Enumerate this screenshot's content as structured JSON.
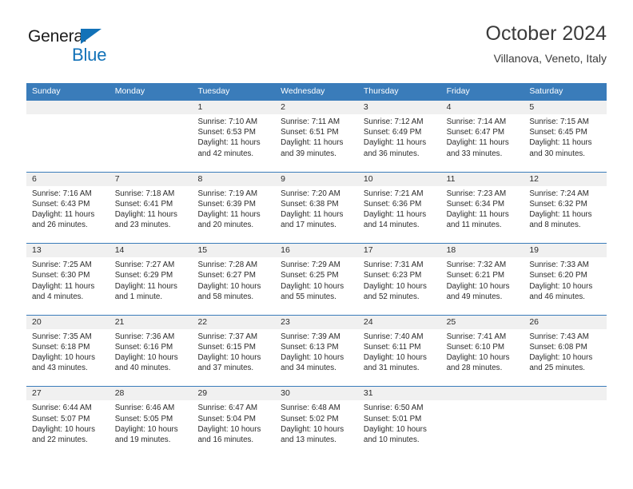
{
  "brand": {
    "name_top": "General",
    "name_bottom": "Blue",
    "triangle_color": "#1272b8",
    "text_color": "#1b1b1b"
  },
  "header": {
    "title": "October 2024",
    "subtitle": "Villanova, Veneto, Italy"
  },
  "colors": {
    "header_blue": "#3a7cba",
    "daynum_strip": "#f0f0f0",
    "text": "#2b2b2b"
  },
  "weekdays": [
    "Sunday",
    "Monday",
    "Tuesday",
    "Wednesday",
    "Thursday",
    "Friday",
    "Saturday"
  ],
  "weeks": [
    [
      {
        "day": "",
        "sunrise": "",
        "sunset": "",
        "daylight_line1": "",
        "daylight_line2": ""
      },
      {
        "day": "",
        "sunrise": "",
        "sunset": "",
        "daylight_line1": "",
        "daylight_line2": ""
      },
      {
        "day": "1",
        "sunrise": "Sunrise: 7:10 AM",
        "sunset": "Sunset: 6:53 PM",
        "daylight_line1": "Daylight: 11 hours",
        "daylight_line2": "and 42 minutes."
      },
      {
        "day": "2",
        "sunrise": "Sunrise: 7:11 AM",
        "sunset": "Sunset: 6:51 PM",
        "daylight_line1": "Daylight: 11 hours",
        "daylight_line2": "and 39 minutes."
      },
      {
        "day": "3",
        "sunrise": "Sunrise: 7:12 AM",
        "sunset": "Sunset: 6:49 PM",
        "daylight_line1": "Daylight: 11 hours",
        "daylight_line2": "and 36 minutes."
      },
      {
        "day": "4",
        "sunrise": "Sunrise: 7:14 AM",
        "sunset": "Sunset: 6:47 PM",
        "daylight_line1": "Daylight: 11 hours",
        "daylight_line2": "and 33 minutes."
      },
      {
        "day": "5",
        "sunrise": "Sunrise: 7:15 AM",
        "sunset": "Sunset: 6:45 PM",
        "daylight_line1": "Daylight: 11 hours",
        "daylight_line2": "and 30 minutes."
      }
    ],
    [
      {
        "day": "6",
        "sunrise": "Sunrise: 7:16 AM",
        "sunset": "Sunset: 6:43 PM",
        "daylight_line1": "Daylight: 11 hours",
        "daylight_line2": "and 26 minutes."
      },
      {
        "day": "7",
        "sunrise": "Sunrise: 7:18 AM",
        "sunset": "Sunset: 6:41 PM",
        "daylight_line1": "Daylight: 11 hours",
        "daylight_line2": "and 23 minutes."
      },
      {
        "day": "8",
        "sunrise": "Sunrise: 7:19 AM",
        "sunset": "Sunset: 6:39 PM",
        "daylight_line1": "Daylight: 11 hours",
        "daylight_line2": "and 20 minutes."
      },
      {
        "day": "9",
        "sunrise": "Sunrise: 7:20 AM",
        "sunset": "Sunset: 6:38 PM",
        "daylight_line1": "Daylight: 11 hours",
        "daylight_line2": "and 17 minutes."
      },
      {
        "day": "10",
        "sunrise": "Sunrise: 7:21 AM",
        "sunset": "Sunset: 6:36 PM",
        "daylight_line1": "Daylight: 11 hours",
        "daylight_line2": "and 14 minutes."
      },
      {
        "day": "11",
        "sunrise": "Sunrise: 7:23 AM",
        "sunset": "Sunset: 6:34 PM",
        "daylight_line1": "Daylight: 11 hours",
        "daylight_line2": "and 11 minutes."
      },
      {
        "day": "12",
        "sunrise": "Sunrise: 7:24 AM",
        "sunset": "Sunset: 6:32 PM",
        "daylight_line1": "Daylight: 11 hours",
        "daylight_line2": "and 8 minutes."
      }
    ],
    [
      {
        "day": "13",
        "sunrise": "Sunrise: 7:25 AM",
        "sunset": "Sunset: 6:30 PM",
        "daylight_line1": "Daylight: 11 hours",
        "daylight_line2": "and 4 minutes."
      },
      {
        "day": "14",
        "sunrise": "Sunrise: 7:27 AM",
        "sunset": "Sunset: 6:29 PM",
        "daylight_line1": "Daylight: 11 hours",
        "daylight_line2": "and 1 minute."
      },
      {
        "day": "15",
        "sunrise": "Sunrise: 7:28 AM",
        "sunset": "Sunset: 6:27 PM",
        "daylight_line1": "Daylight: 10 hours",
        "daylight_line2": "and 58 minutes."
      },
      {
        "day": "16",
        "sunrise": "Sunrise: 7:29 AM",
        "sunset": "Sunset: 6:25 PM",
        "daylight_line1": "Daylight: 10 hours",
        "daylight_line2": "and 55 minutes."
      },
      {
        "day": "17",
        "sunrise": "Sunrise: 7:31 AM",
        "sunset": "Sunset: 6:23 PM",
        "daylight_line1": "Daylight: 10 hours",
        "daylight_line2": "and 52 minutes."
      },
      {
        "day": "18",
        "sunrise": "Sunrise: 7:32 AM",
        "sunset": "Sunset: 6:21 PM",
        "daylight_line1": "Daylight: 10 hours",
        "daylight_line2": "and 49 minutes."
      },
      {
        "day": "19",
        "sunrise": "Sunrise: 7:33 AM",
        "sunset": "Sunset: 6:20 PM",
        "daylight_line1": "Daylight: 10 hours",
        "daylight_line2": "and 46 minutes."
      }
    ],
    [
      {
        "day": "20",
        "sunrise": "Sunrise: 7:35 AM",
        "sunset": "Sunset: 6:18 PM",
        "daylight_line1": "Daylight: 10 hours",
        "daylight_line2": "and 43 minutes."
      },
      {
        "day": "21",
        "sunrise": "Sunrise: 7:36 AM",
        "sunset": "Sunset: 6:16 PM",
        "daylight_line1": "Daylight: 10 hours",
        "daylight_line2": "and 40 minutes."
      },
      {
        "day": "22",
        "sunrise": "Sunrise: 7:37 AM",
        "sunset": "Sunset: 6:15 PM",
        "daylight_line1": "Daylight: 10 hours",
        "daylight_line2": "and 37 minutes."
      },
      {
        "day": "23",
        "sunrise": "Sunrise: 7:39 AM",
        "sunset": "Sunset: 6:13 PM",
        "daylight_line1": "Daylight: 10 hours",
        "daylight_line2": "and 34 minutes."
      },
      {
        "day": "24",
        "sunrise": "Sunrise: 7:40 AM",
        "sunset": "Sunset: 6:11 PM",
        "daylight_line1": "Daylight: 10 hours",
        "daylight_line2": "and 31 minutes."
      },
      {
        "day": "25",
        "sunrise": "Sunrise: 7:41 AM",
        "sunset": "Sunset: 6:10 PM",
        "daylight_line1": "Daylight: 10 hours",
        "daylight_line2": "and 28 minutes."
      },
      {
        "day": "26",
        "sunrise": "Sunrise: 7:43 AM",
        "sunset": "Sunset: 6:08 PM",
        "daylight_line1": "Daylight: 10 hours",
        "daylight_line2": "and 25 minutes."
      }
    ],
    [
      {
        "day": "27",
        "sunrise": "Sunrise: 6:44 AM",
        "sunset": "Sunset: 5:07 PM",
        "daylight_line1": "Daylight: 10 hours",
        "daylight_line2": "and 22 minutes."
      },
      {
        "day": "28",
        "sunrise": "Sunrise: 6:46 AM",
        "sunset": "Sunset: 5:05 PM",
        "daylight_line1": "Daylight: 10 hours",
        "daylight_line2": "and 19 minutes."
      },
      {
        "day": "29",
        "sunrise": "Sunrise: 6:47 AM",
        "sunset": "Sunset: 5:04 PM",
        "daylight_line1": "Daylight: 10 hours",
        "daylight_line2": "and 16 minutes."
      },
      {
        "day": "30",
        "sunrise": "Sunrise: 6:48 AM",
        "sunset": "Sunset: 5:02 PM",
        "daylight_line1": "Daylight: 10 hours",
        "daylight_line2": "and 13 minutes."
      },
      {
        "day": "31",
        "sunrise": "Sunrise: 6:50 AM",
        "sunset": "Sunset: 5:01 PM",
        "daylight_line1": "Daylight: 10 hours",
        "daylight_line2": "and 10 minutes."
      },
      {
        "day": "",
        "sunrise": "",
        "sunset": "",
        "daylight_line1": "",
        "daylight_line2": ""
      },
      {
        "day": "",
        "sunrise": "",
        "sunset": "",
        "daylight_line1": "",
        "daylight_line2": ""
      }
    ]
  ]
}
